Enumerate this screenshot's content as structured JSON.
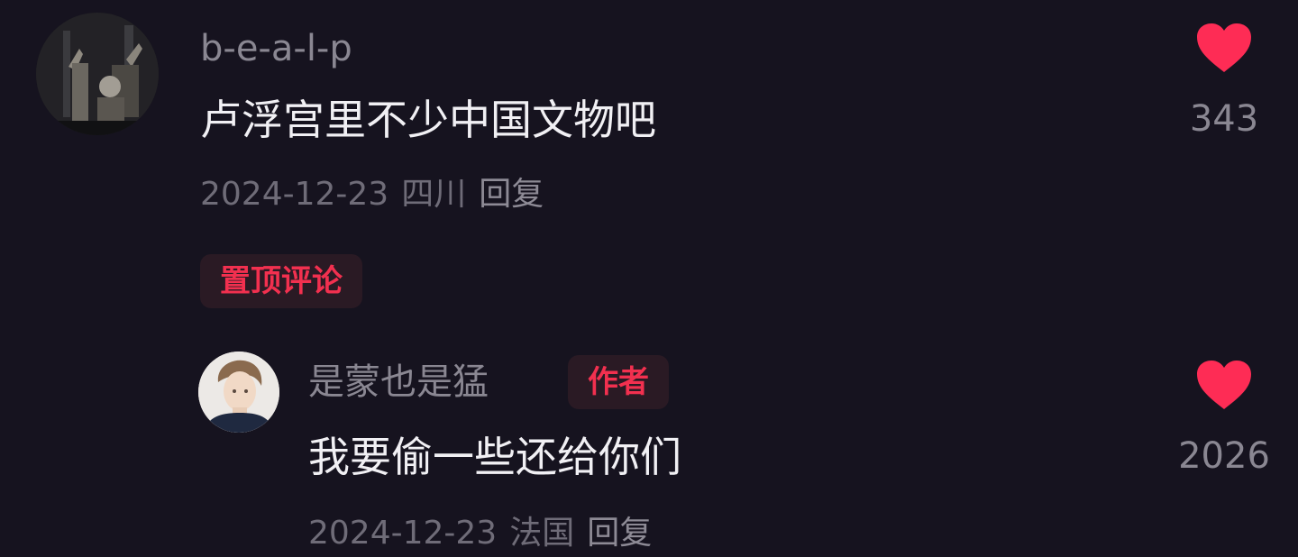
{
  "comments": [
    {
      "username": "b-e-a-l-p",
      "text": "卢浮宫里不少中国文物吧",
      "date": "2024-12-23",
      "location": "四川",
      "reply_label": "回复",
      "like_count": "343",
      "pinned_label": "置顶评论"
    }
  ],
  "replies": [
    {
      "username": "是蒙也是猛",
      "author_label": "作者",
      "text": "我要偷一些还给你们",
      "date": "2024-12-23",
      "location": "法国",
      "reply_label": "回复",
      "like_count": "2026"
    }
  ],
  "colors": {
    "background": "#16131f",
    "like": "#fe2c55",
    "tag_text": "#f2304f",
    "tag_bg": "#2a1a24"
  },
  "icons": {
    "like": "heart-icon"
  }
}
